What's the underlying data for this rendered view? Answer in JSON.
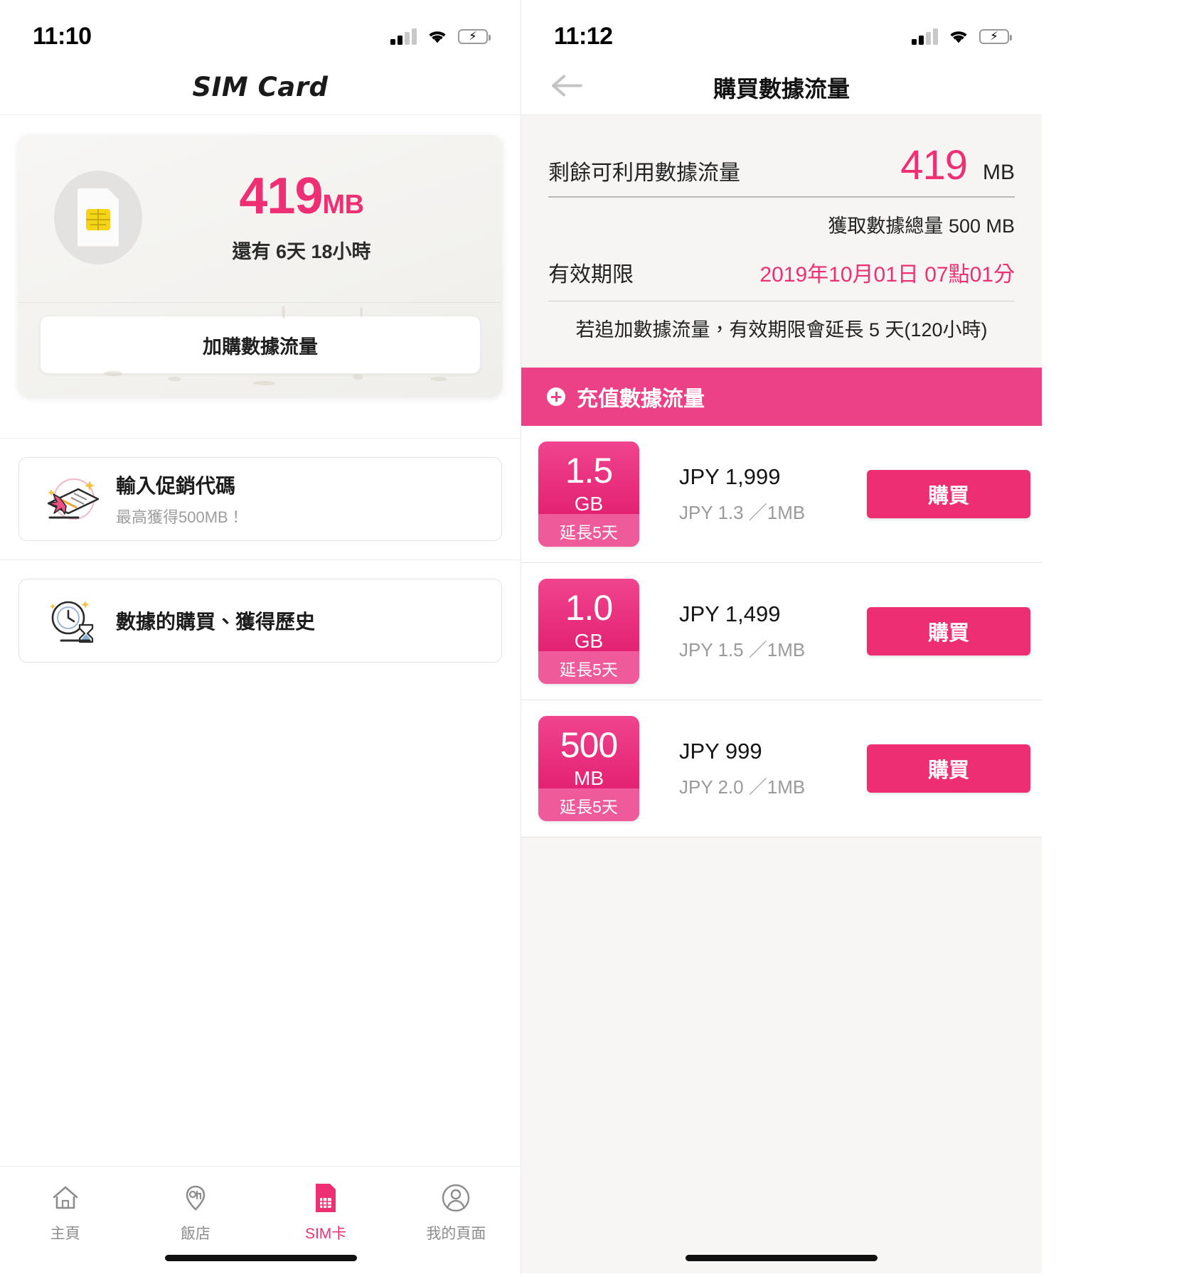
{
  "left": {
    "status": {
      "time": "11:10",
      "signal_icon": "cellular-signal-icon",
      "wifi_icon": "wifi-icon",
      "battery_icon": "battery-charging-icon"
    },
    "nav": {
      "title": "SIM Card"
    },
    "sim_card": {
      "icon": "sim-card-icon",
      "amount": "419",
      "unit": "MB",
      "remaining": "還有 6天 18小時",
      "action_label": "加購數據流量"
    },
    "menu": [
      {
        "icon": "gift-envelope-icon",
        "title": "輸入促銷代碼",
        "subtitle": "最高獲得500MB！"
      },
      {
        "icon": "clock-hourglass-icon",
        "title": "數據的購買、獲得歷史",
        "subtitle": ""
      }
    ],
    "tabs": [
      {
        "icon": "home-icon",
        "label": "主頁",
        "active": false
      },
      {
        "icon": "hotel-pin-icon",
        "label": "飯店",
        "active": false
      },
      {
        "icon": "sim-card-icon",
        "label": "SIM卡",
        "active": true
      },
      {
        "icon": "person-circle-icon",
        "label": "我的頁面",
        "active": false
      }
    ]
  },
  "right": {
    "status": {
      "time": "11:12",
      "signal_icon": "cellular-signal-icon",
      "wifi_icon": "wifi-icon",
      "battery_icon": "battery-charging-icon"
    },
    "nav": {
      "back_icon": "arrow-left-icon",
      "title": "購買數據流量"
    },
    "info": {
      "remaining_label": "剩餘可利用數據流量",
      "remaining_value": "419",
      "remaining_unit": "MB",
      "total_label": "獲取數據總量 500 MB",
      "expiry_label": "有效期限",
      "expiry_value": "2019年10月01日 07點01分",
      "note": "若追加數據流量，有效期限會延長 5 天(120小時)"
    },
    "section": {
      "plus_icon": "plus-circle-icon",
      "title": "充值數據流量"
    },
    "plans": [
      {
        "size": "1.5",
        "size_unit": "GB",
        "extend": "延長5天",
        "price": "JPY 1,999",
        "rate": "JPY 1.3 ／1MB",
        "buy_label": "購買"
      },
      {
        "size": "1.0",
        "size_unit": "GB",
        "extend": "延長5天",
        "price": "JPY 1,499",
        "rate": "JPY 1.5 ／1MB",
        "buy_label": "購買"
      },
      {
        "size": "500",
        "size_unit": "MB",
        "extend": "延長5天",
        "price": "JPY 999",
        "rate": "JPY 2.0 ／1MB",
        "buy_label": "購買"
      }
    ]
  },
  "colors": {
    "accent_pink": "#ef2f73",
    "section_pink": "#ec4186",
    "badge_pink": "#dd1266",
    "battery_green": "#34c759",
    "chip_yellow": "#f5d417"
  }
}
